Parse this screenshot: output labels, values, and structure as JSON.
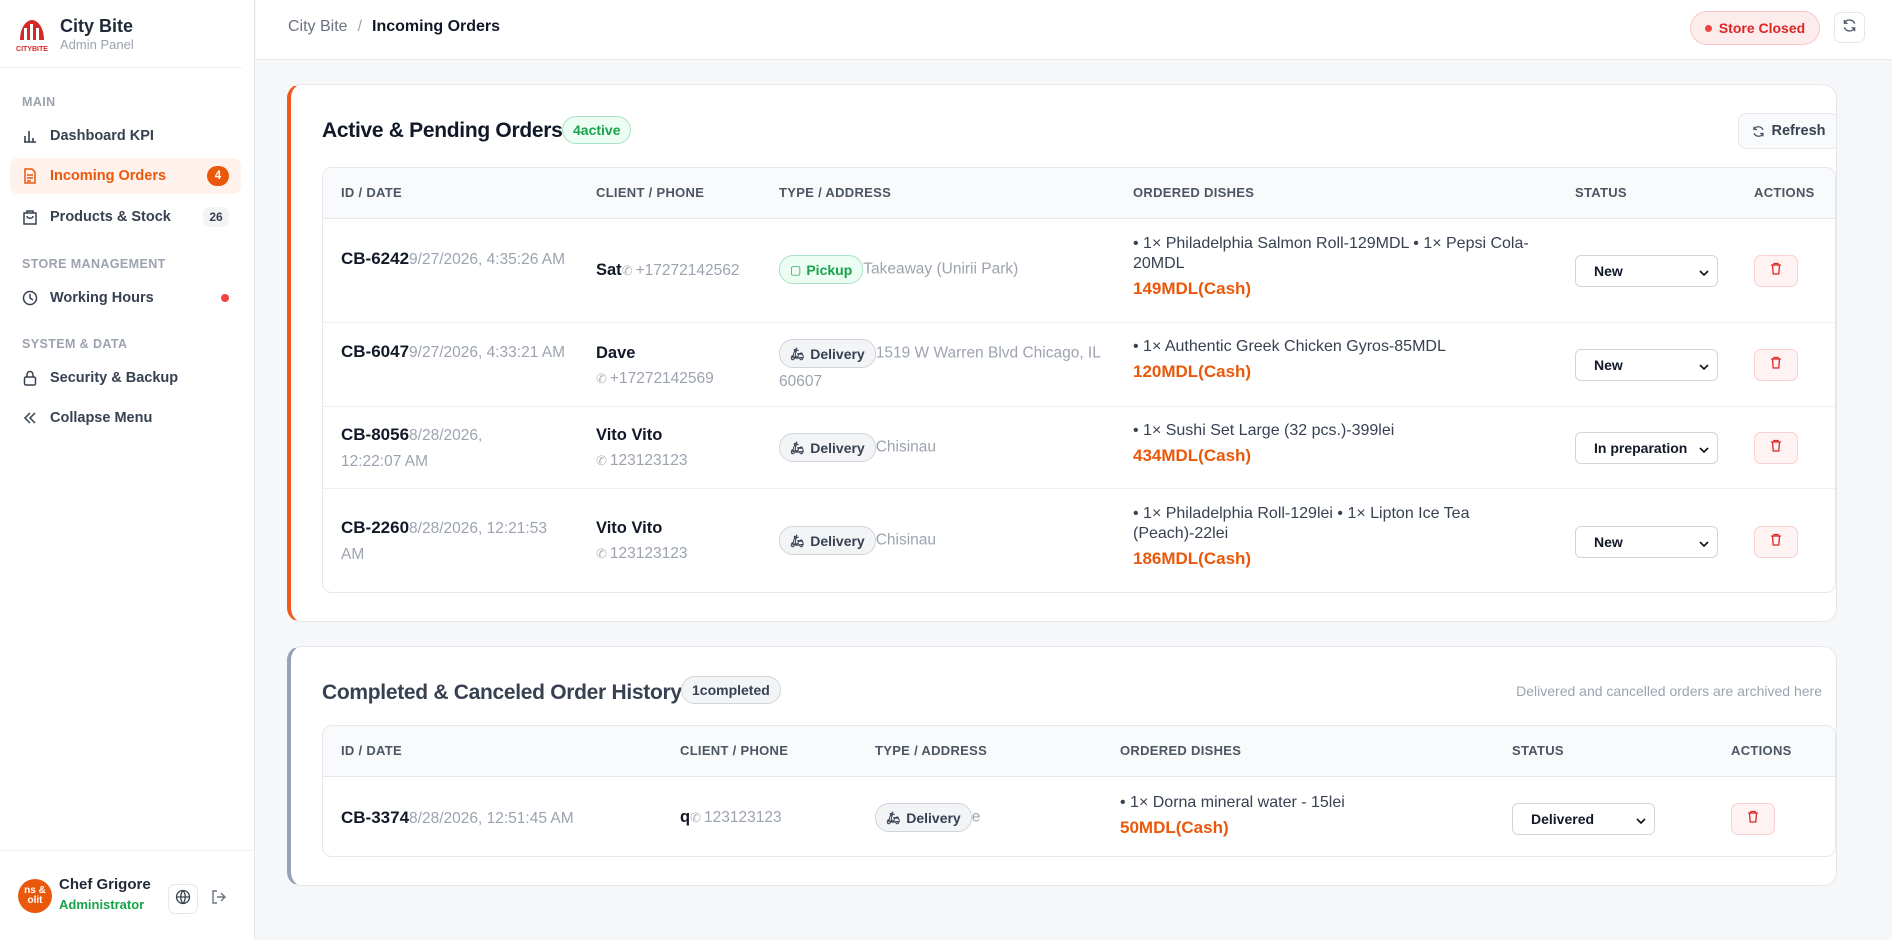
{
  "brand": {
    "name": "City Bite",
    "subtitle": "Admin Panel",
    "logo_text": "CITYBITE"
  },
  "sidebar": {
    "sections": {
      "main": "MAIN",
      "store": "STORE MANAGEMENT",
      "system": "SYSTEM & DATA"
    },
    "items": [
      {
        "label": "Dashboard KPI",
        "icon": "bar-chart-icon"
      },
      {
        "label": "Incoming Orders",
        "icon": "document-icon",
        "badge": "4",
        "active": true
      },
      {
        "label": "Products & Stock",
        "icon": "bag-icon",
        "badge": "26"
      },
      {
        "label": "Working Hours",
        "icon": "clock-icon",
        "dot": true
      },
      {
        "label": "Security & Backup",
        "icon": "lock-icon"
      },
      {
        "label": "Collapse Menu",
        "icon": "double-chevron-left-icon"
      }
    ]
  },
  "user": {
    "name": "Chef Grigore",
    "role": "Administrator",
    "avatar_text": "ns & olit"
  },
  "topbar": {
    "breadcrumb_root": "City Bite",
    "breadcrumb_sep": "/",
    "breadcrumb_current": "Incoming Orders",
    "store_status": "Store Closed"
  },
  "active": {
    "title": "Active & Pending Orders",
    "count_badge": "4active",
    "refresh_label": "Refresh",
    "headers": [
      "ID / DATE",
      "CLIENT / PHONE",
      "TYPE / ADDRESS",
      "ORDERED DISHES",
      "STATUS",
      "ACTIONS"
    ],
    "rows": [
      {
        "id": "CB-6242",
        "date": "9/27/2026, 4:35:26 AM",
        "client": "Sat",
        "phone": "+17272142562",
        "type": "Pickup",
        "address": "Takeaway (Unirii Park)",
        "dishes": "• 1× Philadelphia Salmon Roll-129MDL • 1× Pepsi Cola-20MDL",
        "price": "149MDL(Cash)",
        "status": "New"
      },
      {
        "id": "CB-6047",
        "date": "9/27/2026, 4:33:21 AM",
        "client": "Dave",
        "phone": "+17272142569",
        "type": "Delivery",
        "address": "1519 W Warren Blvd Chicago, IL 60607",
        "dishes": "• 1× Authentic Greek Chicken Gyros-85MDL",
        "price": "120MDL(Cash)",
        "status": "New"
      },
      {
        "id": "CB-8056",
        "date": "8/28/2026, 12:22:07 AM",
        "client": "Vito Vito",
        "phone": "123123123",
        "type": "Delivery",
        "address": "Chisinau",
        "dishes": "• 1× Sushi Set Large (32 pcs.)-399lei",
        "price": "434MDL(Cash)",
        "status": "In preparation"
      },
      {
        "id": "CB-2260",
        "date": "8/28/2026, 12:21:53 AM",
        "client": "Vito Vito",
        "phone": "123123123",
        "type": "Delivery",
        "address": "Chisinau",
        "dishes": "• 1× Philadelphia Roll-129lei • 1× Lipton Ice Tea (Peach)-22lei",
        "price": "186MDL(Cash)",
        "status": "New"
      }
    ]
  },
  "history": {
    "title": "Completed & Canceled Order History",
    "count_badge": "1completed",
    "note": "Delivered and cancelled orders are archived here",
    "headers": [
      "ID / DATE",
      "CLIENT / PHONE",
      "TYPE / ADDRESS",
      "ORDERED DISHES",
      "STATUS",
      "ACTIONS"
    ],
    "rows": [
      {
        "id": "CB-3374",
        "date": "8/28/2026, 12:51:45 AM",
        "client": "q",
        "phone": "123123123",
        "type": "Delivery",
        "address": "e",
        "dishes": "• 1× Dorna mineral water - 15lei",
        "price": "50MDL(Cash)",
        "status": "Delivered"
      }
    ]
  },
  "colors": {
    "accent": "#ea580c",
    "danger": "#dc2626",
    "success": "#16a34a"
  }
}
